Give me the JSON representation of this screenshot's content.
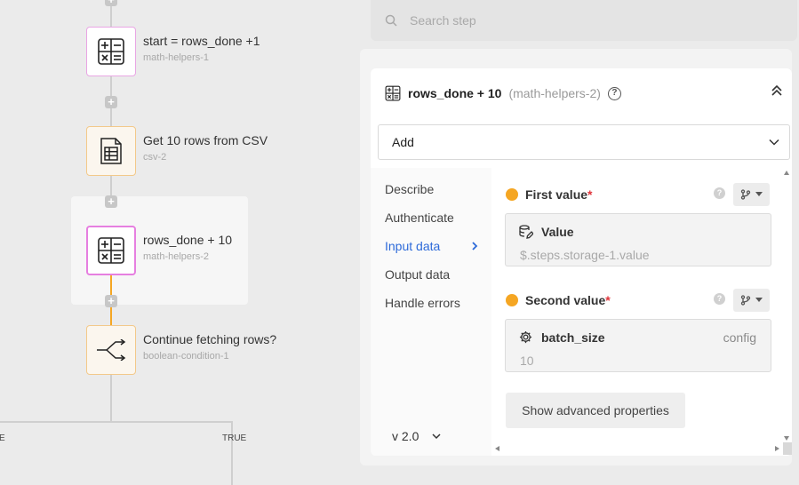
{
  "canvas": {
    "nodes": [
      {
        "title": "start = rows_done +1",
        "subtitle": "math-helpers-1",
        "icon": "calculator-icon"
      },
      {
        "title": "Get 10 rows from CSV",
        "subtitle": "csv-2",
        "icon": "csv-file-icon"
      },
      {
        "title": "rows_done + 10",
        "subtitle": "math-helpers-2",
        "icon": "calculator-icon"
      },
      {
        "title": "Continue fetching rows?",
        "subtitle": "boolean-condition-1",
        "icon": "branch-split-icon"
      }
    ],
    "branch_labels": {
      "false_partial": "E",
      "true": "TRUE"
    },
    "colors": {
      "math_border": "#e67fe0",
      "connector_active": "#f5a623",
      "csv_border": "#f3c98a"
    }
  },
  "search": {
    "placeholder": "Search step"
  },
  "panel": {
    "title": "rows_done + 10",
    "subtitle": "(math-helpers-2)",
    "help": "?",
    "dropdown_value": "Add",
    "nav": [
      {
        "label": "Describe"
      },
      {
        "label": "Authenticate"
      },
      {
        "label": "Input data"
      },
      {
        "label": "Output data"
      },
      {
        "label": "Handle errors"
      }
    ],
    "active_nav": "Input data",
    "version": "v 2.0",
    "fields": [
      {
        "label": "First value",
        "required": "*",
        "value_title": "Value",
        "value_sub": "$.steps.storage-1.value",
        "value_right": ""
      },
      {
        "label": "Second value",
        "required": "*",
        "value_title": "batch_size",
        "value_sub": "10",
        "value_right": "config"
      }
    ],
    "advanced_button": "Show advanced properties",
    "colors": {
      "active_nav": "#2d6ad9",
      "required_dot": "#f5a623",
      "required_star": "#e0353b"
    }
  }
}
